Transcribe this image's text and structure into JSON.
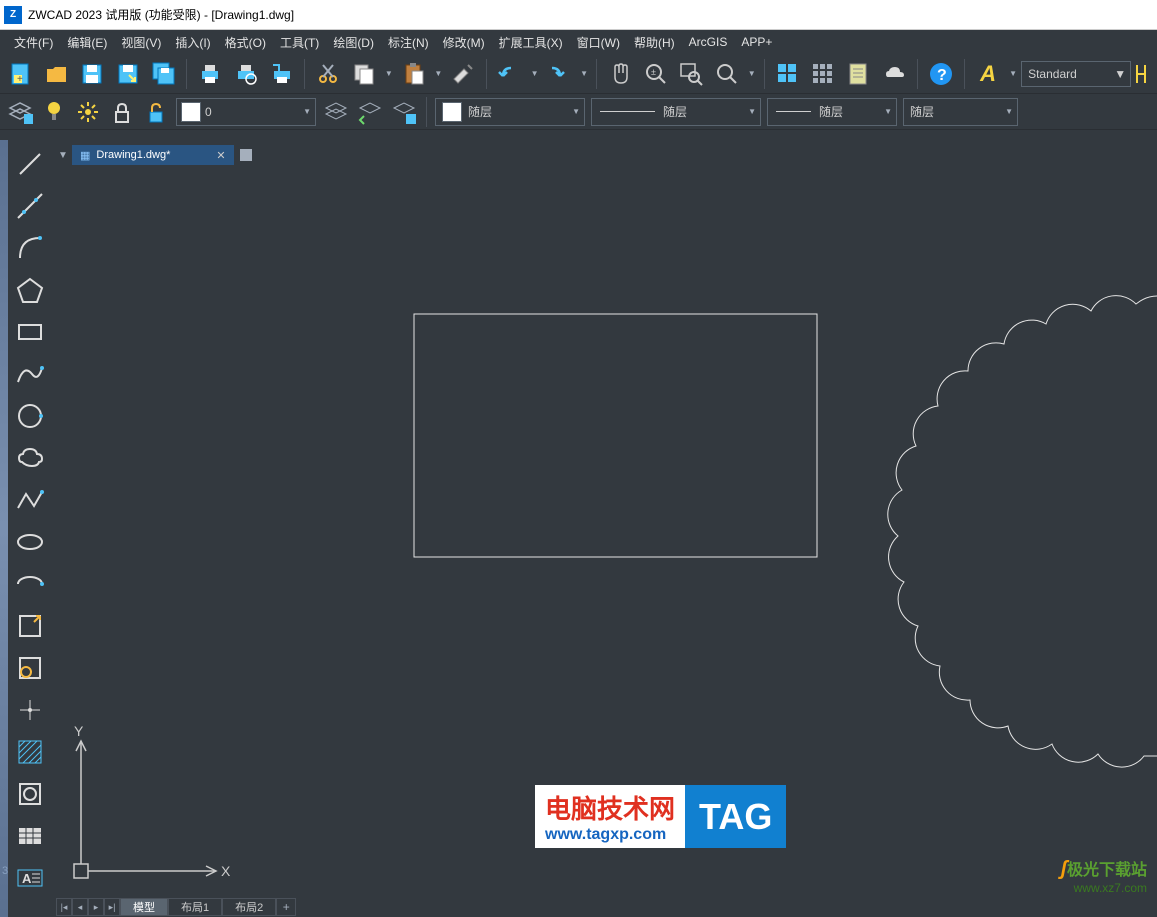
{
  "title": "ZWCAD 2023 试用版 (功能受限) - [Drawing1.dwg]",
  "menu": {
    "file": "文件(F)",
    "edit": "编辑(E)",
    "view": "视图(V)",
    "insert": "插入(I)",
    "format": "格式(O)",
    "tools": "工具(T)",
    "draw": "绘图(D)",
    "annotate": "标注(N)",
    "modify": "修改(M)",
    "extend": "扩展工具(X)",
    "window": "窗口(W)",
    "help": "帮助(H)",
    "arcgis": "ArcGIS",
    "appplus": "APP+"
  },
  "text_style": {
    "label": "Standard"
  },
  "layer_dd": {
    "value": "0"
  },
  "props": {
    "color_bylayer": "随层",
    "linetype_bylayer": "随层",
    "lineweight_bylayer": "随层",
    "plotstyle_bylayer": "随层"
  },
  "doc_tab": {
    "name": "Drawing1.dwg*"
  },
  "layout_tabs": {
    "model": "模型",
    "layout1": "布局1",
    "layout2": "布局2"
  },
  "ucs": {
    "x": "X",
    "y": "Y"
  },
  "side_num": "3",
  "watermark1": {
    "line1": "电脑技术网",
    "line2": "www.tagxp.com",
    "tag": "TAG"
  },
  "watermark2": {
    "name": "极光下载站",
    "url": "www.xz7.com"
  },
  "icons": {
    "new": "new-file-icon",
    "open": "folder-open-icon",
    "save": "save-icon",
    "saveas": "save-as-icon",
    "saveall": "save-all-icon",
    "print": "print-icon",
    "printpreview": "print-preview-icon",
    "plot": "plot-icon",
    "cut": "scissors-icon",
    "copy": "copy-icon",
    "paste": "paste-icon",
    "erase": "erase-icon",
    "undo": "undo-icon",
    "redo": "redo-icon",
    "pan": "pan-hand-icon",
    "zoomrt": "zoom-realtime-icon",
    "zoomwin": "zoom-window-icon",
    "zoomprev": "zoom-previous-icon",
    "grid": "grid-icon",
    "props": "properties-icon",
    "sheet": "sheet-icon",
    "cloud": "cloud-icon",
    "help": "help-icon"
  }
}
